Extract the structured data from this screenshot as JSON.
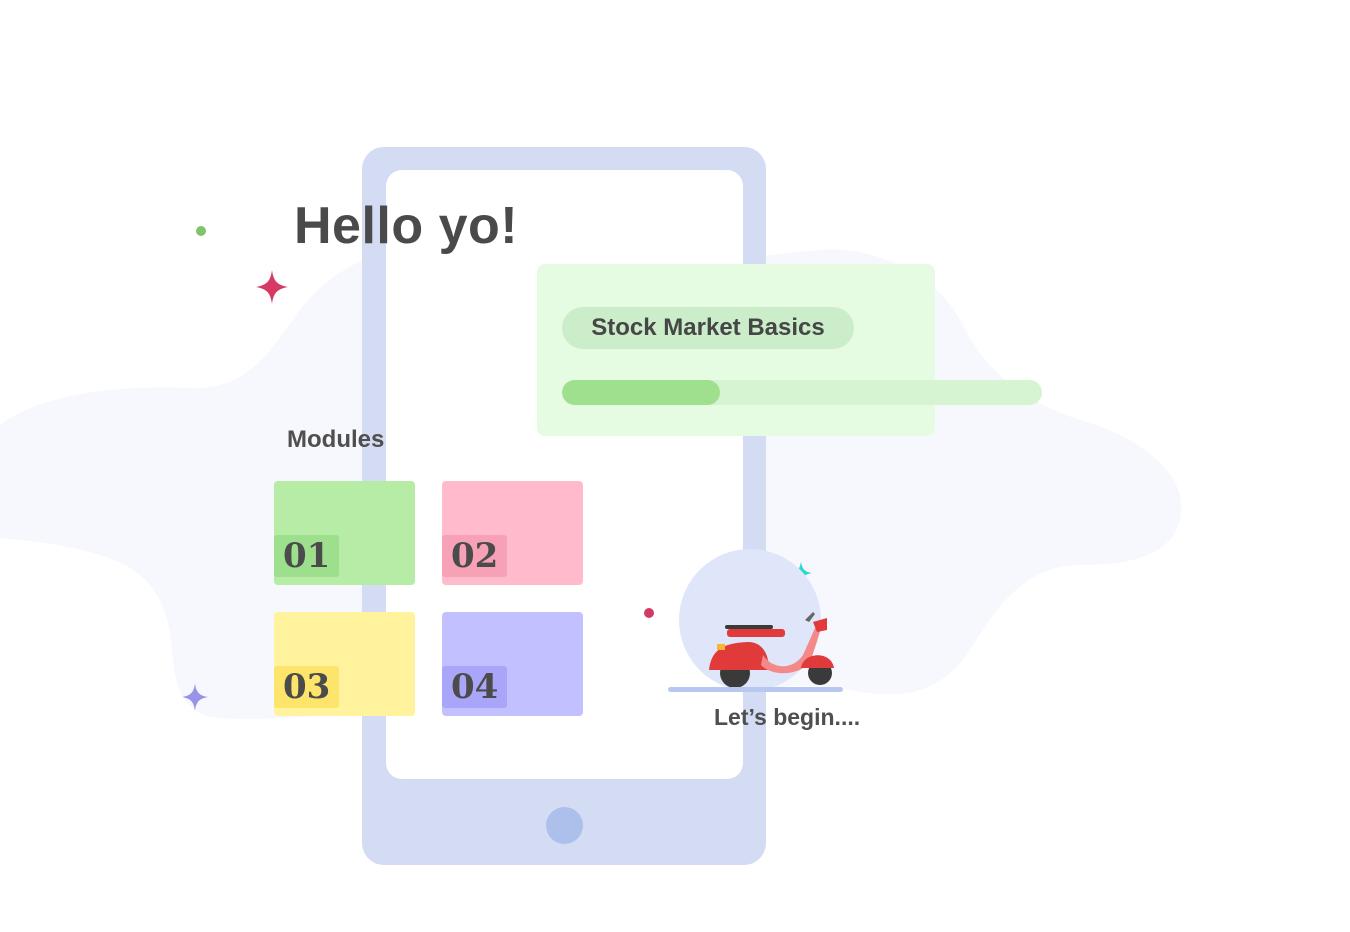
{
  "greeting": "Hello yo!",
  "course": {
    "title": "Stock Market Basics",
    "progress_percent": 33
  },
  "modules": {
    "label": "Modules",
    "items": [
      {
        "number": "01",
        "color": "#b6eca6",
        "tag_color": "#9edf8e"
      },
      {
        "number": "02",
        "color": "#ffbacb",
        "tag_color": "#f7a1b6"
      },
      {
        "number": "03",
        "color": "#fff39d",
        "tag_color": "#fde46a"
      },
      {
        "number": "04",
        "color": "#c3c0ff",
        "tag_color": "#a9a6f9"
      }
    ]
  },
  "start_label": "Let’s begin....",
  "icons": {
    "scooter": "scooter-icon",
    "sparkle_pink": "sparkle-icon",
    "sparkle_teal": "sparkle-icon",
    "sparkle_purple": "sparkle-icon"
  },
  "colors": {
    "phone": "#d4dcf3",
    "blob": "#f7f8fe",
    "text": "#4a4a4a"
  }
}
